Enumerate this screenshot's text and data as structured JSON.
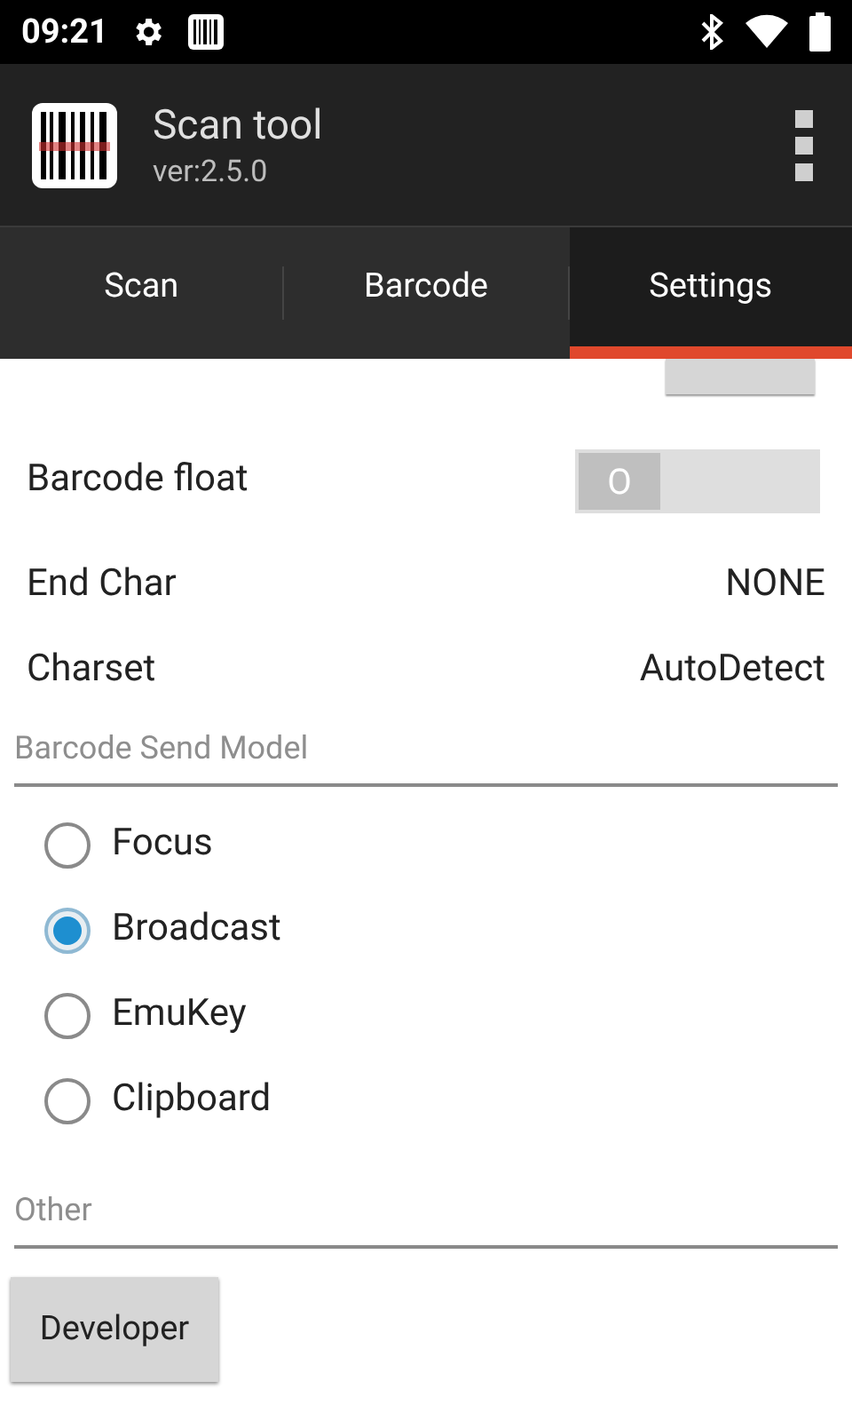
{
  "status_bar": {
    "time": "09:21"
  },
  "app_bar": {
    "title": "Scan tool",
    "subtitle": "ver:2.5.0"
  },
  "tabs": [
    {
      "label": "Scan",
      "selected": false
    },
    {
      "label": "Barcode",
      "selected": false
    },
    {
      "label": "Settings",
      "selected": true
    }
  ],
  "settings": {
    "barcode_float": {
      "label": "Barcode float",
      "on": false,
      "toggle_text": "O"
    },
    "rows": [
      {
        "label": "End Char",
        "value": "NONE"
      },
      {
        "label": "Charset",
        "value": "AutoDetect"
      }
    ]
  },
  "send_model": {
    "heading": "Barcode Send Model",
    "options": [
      {
        "label": "Focus",
        "selected": false
      },
      {
        "label": "Broadcast",
        "selected": true
      },
      {
        "label": "EmuKey",
        "selected": false
      },
      {
        "label": "Clipboard",
        "selected": false
      }
    ]
  },
  "other": {
    "heading": "Other",
    "button": "Developer"
  }
}
